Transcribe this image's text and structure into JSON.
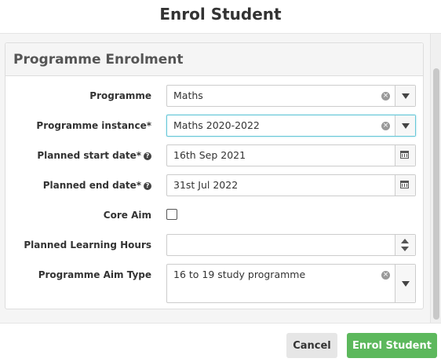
{
  "modal": {
    "title": "Enrol Student"
  },
  "panel": {
    "title": "Programme Enrolment"
  },
  "fields": {
    "programme": {
      "label": "Programme",
      "value": "Maths"
    },
    "programme_instance": {
      "label": "Programme instance*",
      "value": "Maths 2020-2022"
    },
    "planned_start_date": {
      "label": "Planned start date*",
      "value": "16th Sep 2021"
    },
    "planned_end_date": {
      "label": "Planned end date*",
      "value": "31st Jul 2022"
    },
    "core_aim": {
      "label": "Core Aim",
      "checked": false
    },
    "planned_learning_hours": {
      "label": "Planned Learning Hours",
      "value": ""
    },
    "programme_aim_type": {
      "label": "Programme Aim Type",
      "value": "16 to 19 study programme"
    }
  },
  "help_glyph": "?",
  "clear_glyph": "×",
  "footer": {
    "cancel_label": "Cancel",
    "enrol_label": "Enrol Student"
  },
  "colors": {
    "primary_button": "#5cb85c",
    "focus_border": "#66c7d8"
  },
  "icons": [
    "clear-icon",
    "chevron-down-icon",
    "calendar-icon",
    "help-icon",
    "spinner-up-icon",
    "spinner-down-icon"
  ]
}
